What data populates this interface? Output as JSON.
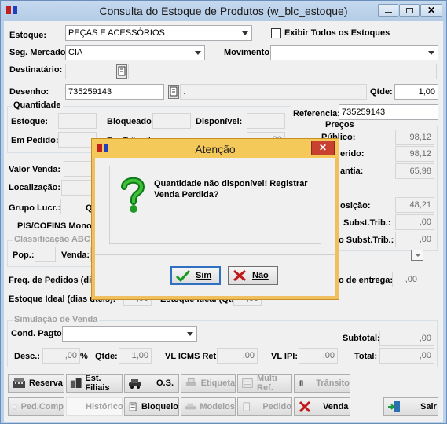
{
  "window": {
    "title": "Consulta do Estoque de Produtos (w_blc_estoque)"
  },
  "top": {
    "estoque_label": "Estoque:",
    "estoque_value": "PEÇAS E ACESSÓRIOS",
    "exibir_label": "Exibir Todos os Estoques",
    "seg_label": "Seg. Mercado:",
    "seg_value": "CIA",
    "movimento_label": "Movimento:",
    "destinatario_label": "Destinatário:",
    "desenho_label": "Desenho:",
    "desenho_value": "735259143",
    "desenho_desc": ".",
    "qtde_label": "Qtde:",
    "qtde_value": "1,00"
  },
  "quantidade": {
    "title": "Quantidade",
    "estoque": "Estoque:",
    "bloqueado": "Bloqueado:",
    "disponivel": "Disponível:",
    "em_pedido": "Em Pedido:",
    "partial_em_transito": "Em Trânsito",
    "partial_val": ",00"
  },
  "referencia": {
    "label": "Referencia:",
    "value": "735259143"
  },
  "precos": {
    "title": "Preços",
    "publico_label": "Público:",
    "publico_value": "98,12",
    "sugerido_label": "erido:",
    "sugerido_value": "98,12",
    "garantia_label": "antia:",
    "garantia_value": "65,98",
    "reposicao_label": "osição:",
    "reposicao_value": "48,21",
    "subst_label": "Subst.Trib.:",
    "subst_value": ",00",
    "osubst_label": "o Subst.Trib.:",
    "osubst_value": ",00"
  },
  "mid": {
    "valor_venda": "Valor Venda:",
    "localizacao": "Localização:",
    "grupo_lucr": "Grupo Lucr.:",
    "q_partial": "Q",
    "pis_cofins": "PIS/COFINS Monofá",
    "classificacao": "Classificação ABC",
    "pop": "Pop.:",
    "venda": "Venda:",
    "freq_pedidos": "Freq. de Pedidos (dias",
    "prazo_entrega": "o de entrega:",
    "prazo_value": ",00",
    "estoque_ideal": "Estoque Ideal (dias úteis):",
    "estoque_ideal_value": ",00",
    "estoque_ideal_qt": "Estoque Ideal (Qt.):",
    "estoque_ideal_qt_value": ",00"
  },
  "simulacao": {
    "title": "Simulação de Venda",
    "cond_pagto": "Cond. Pagto:",
    "subtotal_label": "Subtotal:",
    "subtotal_value": ",00",
    "desc_label": "Desc.:",
    "desc_value": ",00",
    "percent": "%",
    "qtde_label": "Qtde:",
    "qtde_value": "1,00",
    "vl_icms_label": "VL ICMS Ret:",
    "vl_icms_value": ",00",
    "vl_ipi_label": "VL IPI:",
    "vl_ipi_value": ",00",
    "total_label": "Total:",
    "total_value": ",00"
  },
  "buttons": {
    "reserva": "Reserva",
    "est_filiais": "Est. Filiais",
    "os": "O.S.",
    "etiqueta": "Etiqueta",
    "multi_ref": "Multi Ref.",
    "transito": "Trânsito",
    "ped_comp": "Ped.Comp",
    "historico": "Histórico",
    "bloqueio": "Bloqueio",
    "modelos": "Modelos",
    "pedido": "Pedido",
    "venda": "Venda",
    "sair": "Sair"
  },
  "dialog": {
    "title": "Atenção",
    "message": "Quantidade não disponível! Registrar Venda Perdida?",
    "yes": "Sim",
    "no": "Não"
  }
}
